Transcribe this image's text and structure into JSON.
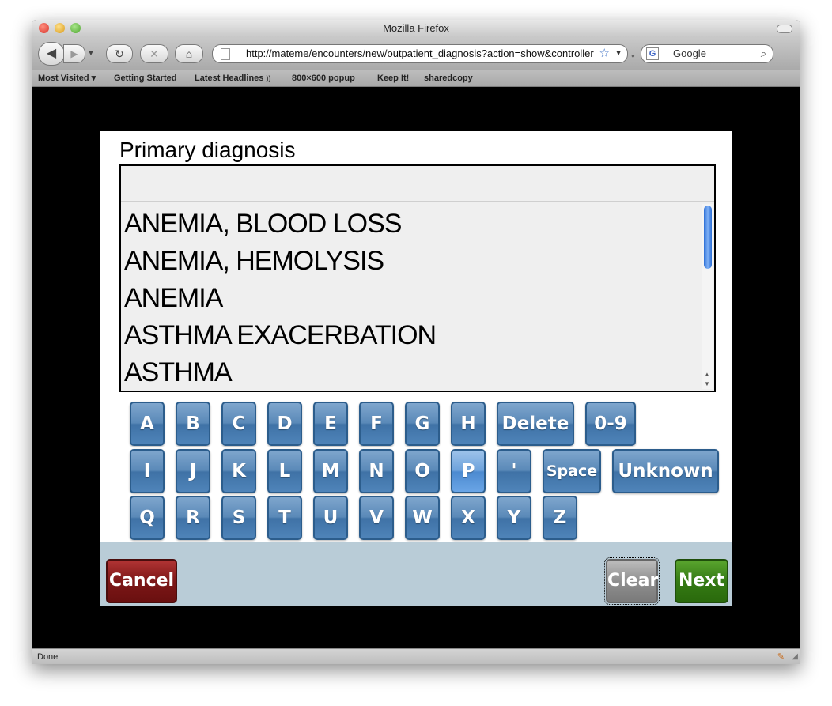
{
  "window": {
    "title": "Mozilla Firefox"
  },
  "navbar": {
    "url": "http://mateme/encounters/new/outpatient_diagnosis?action=show&controller=encounters",
    "search_placeholder": "Google"
  },
  "bookmarks": [
    {
      "label": "Most Visited ▾"
    },
    {
      "label": "Getting Started"
    },
    {
      "label": "Latest Headlines"
    },
    {
      "label": "800×600 popup"
    },
    {
      "label": "Keep It!"
    },
    {
      "label": "sharedcopy"
    }
  ],
  "form": {
    "title": "Primary diagnosis",
    "input_value": "",
    "options": [
      {
        "label": "ANEMIA, BLOOD LOSS"
      },
      {
        "label": "ANEMIA, HEMOLYSIS"
      },
      {
        "label": "ANEMIA"
      },
      {
        "label": "ASTHMA EXACERBATION"
      },
      {
        "label": "ASTHMA"
      }
    ]
  },
  "keyboard": {
    "row1": [
      "A",
      "B",
      "C",
      "D",
      "E",
      "F",
      "G",
      "H",
      "Delete",
      "0-9"
    ],
    "row2": [
      "I",
      "J",
      "K",
      "L",
      "M",
      "N",
      "O",
      "P",
      "'",
      "Space",
      "Unknown"
    ],
    "row3": [
      "Q",
      "R",
      "S",
      "T",
      "U",
      "V",
      "W",
      "X",
      "Y",
      "Z"
    ]
  },
  "buttons": {
    "cancel": "Cancel",
    "clear": "Clear",
    "next": "Next"
  },
  "status": {
    "text": "Done"
  }
}
